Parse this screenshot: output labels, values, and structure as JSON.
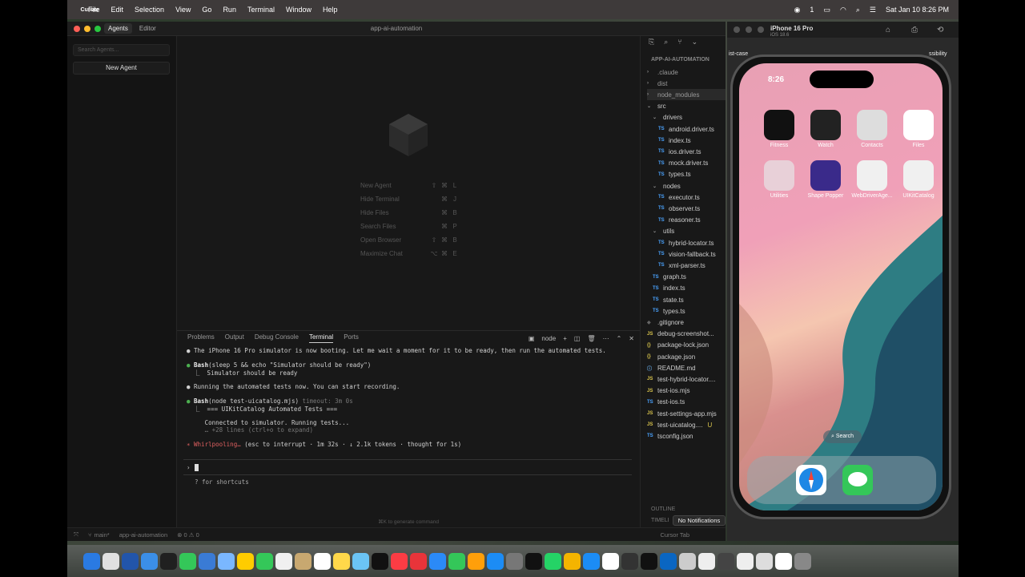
{
  "menubar": {
    "app": "Cursor",
    "items": [
      "File",
      "Edit",
      "Selection",
      "View",
      "Go",
      "Run",
      "Terminal",
      "Window",
      "Help"
    ],
    "clock": "Sat Jan 10  8:26 PM",
    "badge": "1"
  },
  "cursor": {
    "title": "app-ai-automation",
    "tabs": [
      "Agents",
      "Editor"
    ],
    "search_placeholder": "Search Agents...",
    "new_agent": "New Agent",
    "shortcuts": [
      {
        "label": "New Agent",
        "keys": [
          "⇧",
          "⌘",
          "L"
        ]
      },
      {
        "label": "Hide Terminal",
        "keys": [
          "⌘",
          "J"
        ]
      },
      {
        "label": "Hide Files",
        "keys": [
          "⌘",
          "B"
        ]
      },
      {
        "label": "Search Files",
        "keys": [
          "⌘",
          "P"
        ]
      },
      {
        "label": "Open Browser",
        "keys": [
          "⇧",
          "⌘",
          "B"
        ]
      },
      {
        "label": "Maximize Chat",
        "keys": [
          "⌥",
          "⌘",
          "E"
        ]
      }
    ],
    "panel_tabs": [
      "Problems",
      "Output",
      "Debug Console",
      "Terminal",
      "Ports"
    ],
    "active_panel": "Terminal",
    "shell": "node",
    "terminal": {
      "l1": "The iPhone 16 Pro simulator is now booting. Let me wait a moment for it to be ready, then run the automated tests.",
      "l2a": "Bash",
      "l2b": "(sleep 5 && echo \"Simulator should be ready\")",
      "l3": "⎿  Simulator should be ready",
      "l4": "Running the automated tests now. You can start recording.",
      "l5a": "Bash",
      "l5b": "(node test-uicatalog.mjs)",
      "l5c": " timeout: 3m 0s",
      "l6": "⎿  === UIKitCatalog Automated Tests ===",
      "l7": "Connected to simulator. Running tests...",
      "l8": "… +28 lines (ctrl+o to expand)",
      "l9a": "Whirlpooling…",
      "l9b": " (esc to interrupt · 1m 32s · ↓ 2.1k tokens · thought for 1s)",
      "prompt": "›",
      "hint": "? for shortcuts"
    },
    "generate_hint": "⌘K to generate command",
    "explorer_header": "APP-AI-AUTOMATION",
    "files": [
      {
        "name": ".claude",
        "kind": "folder",
        "ind": 0
      },
      {
        "name": "dist",
        "kind": "folder",
        "ind": 0
      },
      {
        "name": "node_modules",
        "kind": "folder",
        "ind": 0
      },
      {
        "name": "src",
        "kind": "open",
        "ind": 0
      },
      {
        "name": "drivers",
        "kind": "open",
        "ind": 1
      },
      {
        "name": "android.driver.ts",
        "kind": "ts",
        "ind": 2
      },
      {
        "name": "index.ts",
        "kind": "ts",
        "ind": 2
      },
      {
        "name": "ios.driver.ts",
        "kind": "ts",
        "ind": 2
      },
      {
        "name": "mock.driver.ts",
        "kind": "ts",
        "ind": 2
      },
      {
        "name": "types.ts",
        "kind": "ts",
        "ind": 2
      },
      {
        "name": "nodes",
        "kind": "open",
        "ind": 1
      },
      {
        "name": "executor.ts",
        "kind": "ts",
        "ind": 2
      },
      {
        "name": "observer.ts",
        "kind": "ts",
        "ind": 2
      },
      {
        "name": "reasoner.ts",
        "kind": "ts",
        "ind": 2
      },
      {
        "name": "utils",
        "kind": "open",
        "ind": 1
      },
      {
        "name": "hybrid-locator.ts",
        "kind": "ts",
        "ind": 2
      },
      {
        "name": "vision-fallback.ts",
        "kind": "ts",
        "ind": 2
      },
      {
        "name": "xml-parser.ts",
        "kind": "ts",
        "ind": 2
      },
      {
        "name": "graph.ts",
        "kind": "ts",
        "ind": 1
      },
      {
        "name": "index.ts",
        "kind": "ts",
        "ind": 1
      },
      {
        "name": "state.ts",
        "kind": "ts",
        "ind": 1
      },
      {
        "name": "types.ts",
        "kind": "ts",
        "ind": 1
      },
      {
        "name": ".gitignore",
        "kind": "git",
        "ind": 0
      },
      {
        "name": "debug-screenshot...",
        "kind": "js",
        "ind": 0
      },
      {
        "name": "package-lock.json",
        "kind": "json",
        "ind": 0
      },
      {
        "name": "package.json",
        "kind": "json",
        "ind": 0
      },
      {
        "name": "README.md",
        "kind": "md",
        "ind": 0
      },
      {
        "name": "test-hybrid-locator....",
        "kind": "js",
        "ind": 0
      },
      {
        "name": "test-ios.mjs",
        "kind": "js",
        "ind": 0
      },
      {
        "name": "test-ios.ts",
        "kind": "ts",
        "ind": 0
      },
      {
        "name": "test-settings-app.mjs",
        "kind": "js",
        "ind": 0
      },
      {
        "name": "test-uicatalog....",
        "kind": "js",
        "ind": 0,
        "badge": "U"
      },
      {
        "name": "tsconfig.json",
        "kind": "ts",
        "ind": 0
      }
    ],
    "outline": "OUTLINE",
    "timeline": "TIMELI",
    "status": {
      "branch": "main*",
      "project": "app-ai-automation",
      "counts": "⊗ 0 ⚠ 0",
      "cursor_tab": "Cursor Tab"
    }
  },
  "sim": {
    "title": "iPhone 16 Pro",
    "os": "iOS 18.6",
    "time": "8:26",
    "search": "Search",
    "overlay_left": "ist-case",
    "overlay_right": "ssibility",
    "apps": [
      {
        "name": "Fitness",
        "color": "#111"
      },
      {
        "name": "Watch",
        "color": "#222"
      },
      {
        "name": "Contacts",
        "color": "#ddd"
      },
      {
        "name": "Files",
        "color": "#fff"
      },
      {
        "name": "Utilities",
        "color": "#e8d0d8"
      },
      {
        "name": "Shape Popper",
        "color": "#3a2a8a"
      },
      {
        "name": "WebDriverAge...",
        "color": "#f0f0f0"
      },
      {
        "name": "UIKitCatalog",
        "color": "#f0f0f0"
      }
    ]
  },
  "notification": "No Notifications"
}
